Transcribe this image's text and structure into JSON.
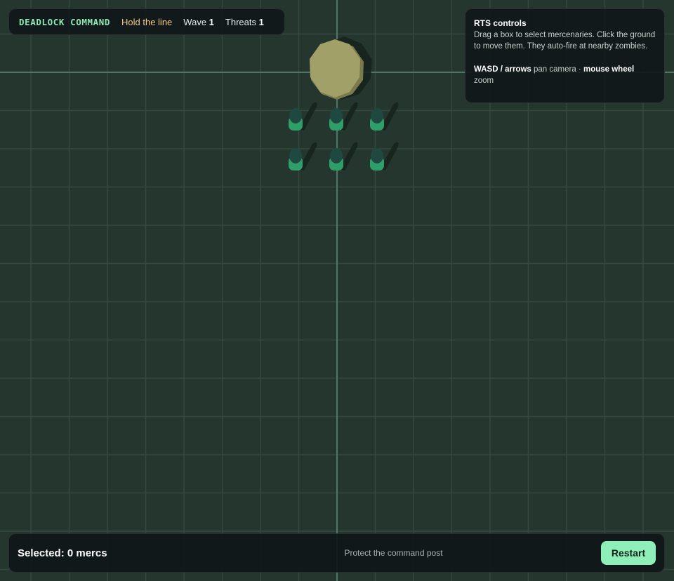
{
  "hud": {
    "title": "DEADLOCK COMMAND",
    "mission": "Hold the line",
    "wave_label": "Wave",
    "wave_value": "1",
    "threats_label": "Threats",
    "threats_value": "1"
  },
  "help": {
    "title": "RTS controls",
    "line1": "Drag a box to select mercenaries. Click the ground to move them. They auto-fire at nearby zombies.",
    "keys_bold": "WASD / arrows",
    "keys_text": " pan camera · ",
    "wheel_bold": "mouse wheel",
    "wheel_text": " zoom"
  },
  "bottom": {
    "selected": "Selected: 0 mercs",
    "objective": "Protect the command post",
    "restart_label": "Restart"
  },
  "scene": {
    "command_post": "command-post",
    "mercenary_count": 6,
    "mercenary_formation": [
      [
        0,
        0
      ],
      [
        1,
        0
      ],
      [
        2,
        0
      ],
      [
        0,
        1
      ],
      [
        1,
        1
      ],
      [
        2,
        1
      ]
    ]
  },
  "colors": {
    "ground": "#24362d",
    "grid": "#34483f",
    "axis": "#4f7565",
    "title": "#8ee8b4",
    "mission": "#f0c98a",
    "command_post": "#a0a068",
    "merc_body": "#2f9f6a",
    "merc_head": "#1e4840",
    "restart_bg": "#8ef0b8"
  }
}
